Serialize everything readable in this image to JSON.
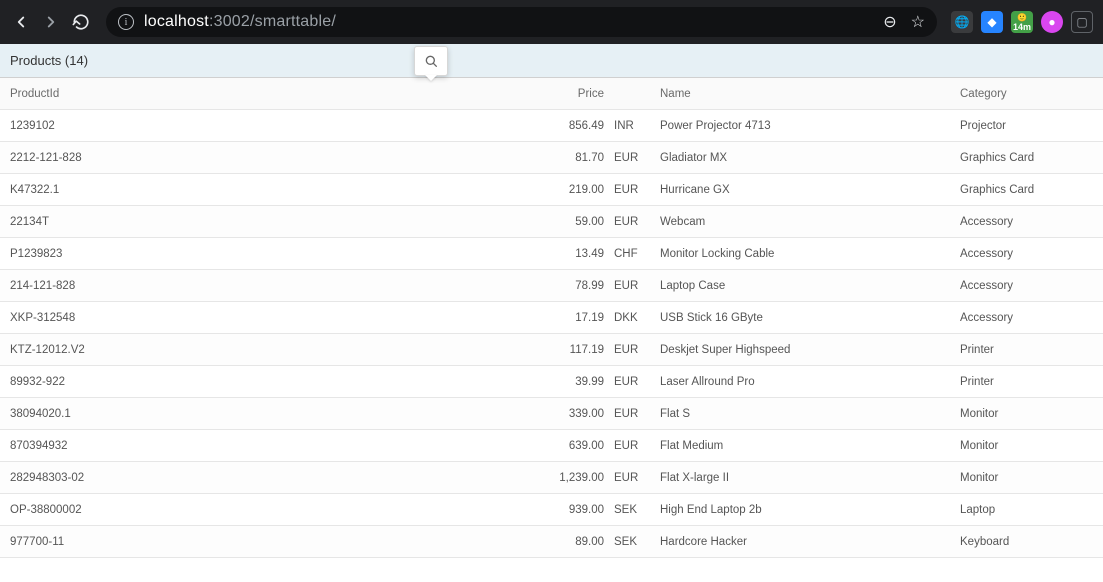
{
  "browser": {
    "url_host": "localhost",
    "url_rest": ":3002/smarttable/",
    "info_glyph": "i",
    "zoom_glyph": "⊖",
    "star_glyph": "☆",
    "ext_globe": "🌐",
    "ext_blue": "◆",
    "ext_badge_text": "14m",
    "ext_pink": "●",
    "ext_box": "▢"
  },
  "toolbar": {
    "title": "Products (14)"
  },
  "columns": {
    "product_id": "ProductId",
    "price": "Price",
    "currency": "",
    "name": "Name",
    "category": "Category"
  },
  "rows": [
    {
      "id": "1239102",
      "price": "856.49",
      "currency": "INR",
      "name": "Power Projector 4713",
      "category": "Projector"
    },
    {
      "id": "2212-121-828",
      "price": "81.70",
      "currency": "EUR",
      "name": "Gladiator MX",
      "category": "Graphics Card"
    },
    {
      "id": "K47322.1",
      "price": "219.00",
      "currency": "EUR",
      "name": "Hurricane GX",
      "category": "Graphics Card"
    },
    {
      "id": "22134T",
      "price": "59.00",
      "currency": "EUR",
      "name": "Webcam",
      "category": "Accessory"
    },
    {
      "id": "P1239823",
      "price": "13.49",
      "currency": "CHF",
      "name": "Monitor Locking Cable",
      "category": "Accessory"
    },
    {
      "id": "214-121-828",
      "price": "78.99",
      "currency": "EUR",
      "name": "Laptop Case",
      "category": "Accessory"
    },
    {
      "id": "XKP-312548",
      "price": "17.19",
      "currency": "DKK",
      "name": "USB Stick 16 GByte",
      "category": "Accessory"
    },
    {
      "id": "KTZ-12012.V2",
      "price": "117.19",
      "currency": "EUR",
      "name": "Deskjet Super Highspeed",
      "category": "Printer"
    },
    {
      "id": "89932-922",
      "price": "39.99",
      "currency": "EUR",
      "name": "Laser Allround Pro",
      "category": "Printer"
    },
    {
      "id": "38094020.1",
      "price": "339.00",
      "currency": "EUR",
      "name": "Flat S",
      "category": "Monitor"
    },
    {
      "id": "870394932",
      "price": "639.00",
      "currency": "EUR",
      "name": "Flat Medium",
      "category": "Monitor"
    },
    {
      "id": "282948303-02",
      "price": "1,239.00",
      "currency": "EUR",
      "name": "Flat X-large II",
      "category": "Monitor"
    },
    {
      "id": "OP-38800002",
      "price": "939.00",
      "currency": "SEK",
      "name": "High End Laptop 2b",
      "category": "Laptop"
    },
    {
      "id": "977700-11",
      "price": "89.00",
      "currency": "SEK",
      "name": "Hardcore Hacker",
      "category": "Keyboard"
    }
  ]
}
